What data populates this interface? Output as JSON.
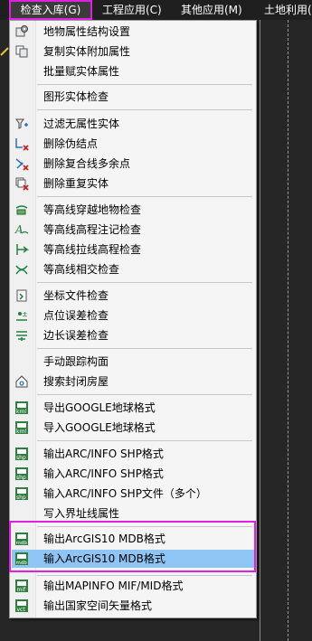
{
  "menubar": {
    "items": [
      {
        "label": "检查入库(G)"
      },
      {
        "label": "工程应用(C)"
      },
      {
        "label": "其他应用(M)"
      },
      {
        "label": "土地利用("
      }
    ]
  },
  "menu": {
    "items": [
      {
        "label": "地物属性结构设置",
        "icon": "gear-layers-icon"
      },
      {
        "label": "复制实体附加属性",
        "icon": "copy-icon"
      },
      {
        "label": "批量赋实体属性",
        "icon": ""
      },
      {
        "label": "图形实体检查",
        "icon": ""
      },
      {
        "label": "过滤无属性实体",
        "icon": "filter-icon"
      },
      {
        "label": "删除伪结点",
        "icon": "delete-node-icon"
      },
      {
        "label": "删除复合线多余点",
        "icon": "delete-polyline-points-icon"
      },
      {
        "label": "删除重复实体",
        "icon": "delete-duplicate-icon"
      },
      {
        "label": "等高线穿越地物检查",
        "icon": "contour-cross-icon"
      },
      {
        "label": "等高线高程注记检查",
        "icon": "contour-annotation-icon"
      },
      {
        "label": "等高线拉线高程检查",
        "icon": "contour-line-icon"
      },
      {
        "label": "等高线相交检查",
        "icon": "contour-intersect-icon"
      },
      {
        "label": "坐标文件检查",
        "icon": "coord-file-icon"
      },
      {
        "label": "点位误差检查",
        "icon": "point-error-icon"
      },
      {
        "label": "边长误差检查",
        "icon": "edge-error-icon"
      },
      {
        "label": "手动跟踪构面",
        "icon": ""
      },
      {
        "label": "搜索封闭房屋",
        "icon": "house-icon"
      },
      {
        "label": "导出GOOGLE地球格式",
        "icon": "kml-export-icon"
      },
      {
        "label": "导入GOOGLE地球格式",
        "icon": "kml-import-icon"
      },
      {
        "label": "输出ARC/INFO SHP格式",
        "icon": "shp-export-icon"
      },
      {
        "label": "输入ARC/INFO SHP格式",
        "icon": "shp-import-icon"
      },
      {
        "label": "输入ARC/INFO SHP文件（多个）",
        "icon": "shp-multi-import-icon"
      },
      {
        "label": "写入界址线属性",
        "icon": ""
      },
      {
        "label": "输出ArcGIS10 MDB格式",
        "icon": "mdb-export-icon"
      },
      {
        "label": "输入ArcGIS10 MDB格式",
        "icon": "mdb-import-icon"
      },
      {
        "label": "输出MAPINFO MIF/MID格式",
        "icon": "mif-export-icon"
      },
      {
        "label": "输出国家空间矢量格式",
        "icon": "vct-export-icon"
      }
    ]
  },
  "colors": {
    "highlight": "#8ec5f5",
    "annotation": "#e020e0",
    "menu_bg": "#f5f5f5",
    "menubar_bg": "#1f1f1f"
  }
}
